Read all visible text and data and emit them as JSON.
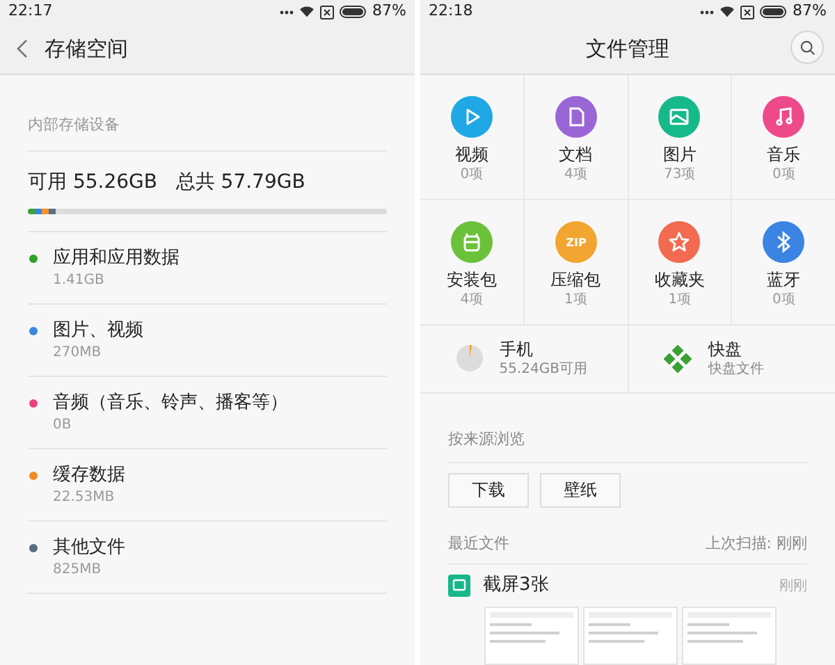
{
  "left": {
    "status_bar": {
      "time": "22:17",
      "battery": "87%"
    },
    "title": "存储空间",
    "section_label": "内部存储设备",
    "summary": "可用 55.26GB   总共 57.79GB",
    "usage_segments": [
      {
        "color": "#3aa332"
      },
      {
        "color": "#3b86da"
      },
      {
        "color": "#f2922e"
      },
      {
        "color": "#5a6f8c"
      }
    ],
    "items": [
      {
        "name": "应用和应用数据",
        "size": "1.41GB",
        "color": "#2fa22b"
      },
      {
        "name": "图片、视频",
        "size": "270MB",
        "color": "#3a86dc"
      },
      {
        "name": "音频（音乐、铃声、播客等）",
        "size": "0B",
        "color": "#e8447f"
      },
      {
        "name": "缓存数据",
        "size": "22.53MB",
        "color": "#f28a24"
      },
      {
        "name": "其他文件",
        "size": "825MB",
        "color": "#5b6b82"
      }
    ]
  },
  "right": {
    "status_bar": {
      "time": "22:18",
      "battery": "87%"
    },
    "title": "文件管理",
    "categories": [
      {
        "kind": "video",
        "label": "视频",
        "count": "0项",
        "color": "#1fa8e3"
      },
      {
        "kind": "document",
        "label": "文档",
        "count": "4项",
        "color": "#9a66d6"
      },
      {
        "kind": "image",
        "label": "图片",
        "count": "73项",
        "color": "#16b98a"
      },
      {
        "kind": "music",
        "label": "音乐",
        "count": "0项",
        "color": "#ee4a8b"
      },
      {
        "kind": "apk",
        "label": "安装包",
        "count": "4项",
        "color": "#6cc13a"
      },
      {
        "kind": "zip",
        "label": "压缩包",
        "count": "1项",
        "color": "#f2a531",
        "badge": "ZIP"
      },
      {
        "kind": "favorite",
        "label": "收藏夹",
        "count": "1项",
        "color": "#f26a4f"
      },
      {
        "kind": "bluetooth",
        "label": "蓝牙",
        "count": "0项",
        "color": "#3b84e4"
      }
    ],
    "storages": [
      {
        "kind": "phone",
        "name": "手机",
        "detail": "55.24GB可用"
      },
      {
        "kind": "cloud",
        "name": "快盘",
        "detail": "快盘文件"
      }
    ],
    "source_label": "按来源浏览",
    "sources": [
      "下载",
      "壁纸"
    ],
    "recent_label": "最近文件",
    "last_scan": "上次扫描: 刚刚",
    "recent": [
      {
        "name": "截屏3张",
        "time": "刚刚",
        "thumbnails": [
          {
            "kind": "screenshot"
          },
          {
            "kind": "screenshot"
          },
          {
            "kind": "screenshot"
          }
        ]
      }
    ]
  }
}
